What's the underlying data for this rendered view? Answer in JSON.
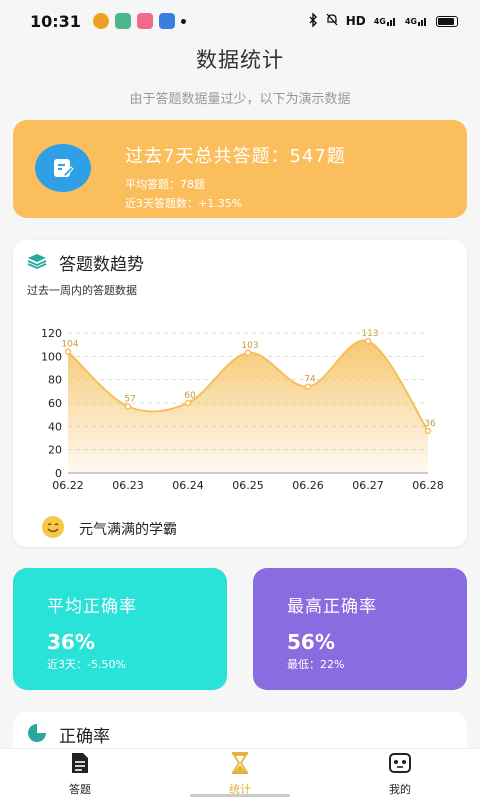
{
  "status_bar": {
    "time": "10:31",
    "network": "HD",
    "signal1": "4G",
    "signal2": "4G"
  },
  "header": {
    "title": "数据统计",
    "subtitle": "由于答题数据量过少，以下为演示数据"
  },
  "summary": {
    "headline": "过去7天总共答题：547题",
    "avg_line": "平均答题：78题",
    "recent_line": "近3天答题数：+1.35%",
    "icon": "edit-note-icon",
    "colors": {
      "card": "#fbbe5d",
      "icon_bg": "#2ea0e6"
    }
  },
  "trend_card": {
    "title": "答题数趋势",
    "subtitle": "过去一周内的答题数据",
    "footer": "元气满满的学霸",
    "icon": "layers-icon",
    "footer_icon": "smile-emoji-icon"
  },
  "chart_data": {
    "type": "area",
    "x": [
      "06.22",
      "06.23",
      "06.24",
      "06.25",
      "06.26",
      "06.27",
      "06.28"
    ],
    "values": [
      104,
      57,
      60,
      103,
      74,
      113,
      36
    ],
    "data_labels": [
      "104",
      "57",
      "60",
      "103",
      "74",
      "113",
      "36"
    ],
    "y_ticks": [
      "0",
      "20",
      "40",
      "60",
      "80",
      "100",
      "120"
    ],
    "ylim": [
      0,
      120
    ],
    "grid": true,
    "smooth": true,
    "color": "#f5bf5a"
  },
  "stats": {
    "avg": {
      "label": "平均正确率",
      "value": "36%",
      "note": "近3天：-5.50%",
      "color": "#29e2d8"
    },
    "max": {
      "label": "最高正确率",
      "value": "56%",
      "note": "最低：22%",
      "color": "#8a6be0"
    }
  },
  "accuracy": {
    "title": "正确率",
    "icon": "pie-chart-icon"
  },
  "tabs": [
    {
      "label": "答题",
      "icon": "document-icon",
      "active": false
    },
    {
      "label": "统计",
      "icon": "hourglass-icon",
      "active": true
    },
    {
      "label": "我的",
      "icon": "robot-face-icon",
      "active": false
    }
  ]
}
